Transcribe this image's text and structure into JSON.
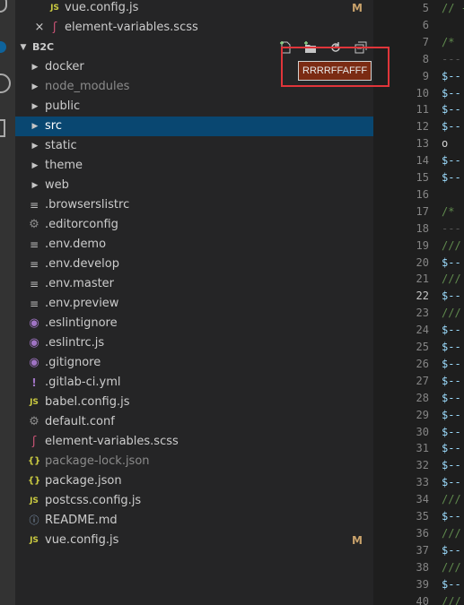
{
  "open_editors": [
    {
      "label": "vue.config.js",
      "icon": "js-file-icon",
      "badge": "M",
      "close": ""
    },
    {
      "label": "element-variables.scss",
      "icon": "sass-file-icon",
      "badge": "",
      "close": "×"
    }
  ],
  "section": {
    "title": "B2C"
  },
  "toolbar": {
    "new_file": "new-file",
    "new_folder": "new-folder",
    "refresh": "refresh",
    "collapse_all": "collapse-all"
  },
  "tooltip": {
    "text": "RRRRFFAFFF"
  },
  "tree": [
    {
      "label": "docker",
      "type": "folder",
      "dim": false,
      "selected": false
    },
    {
      "label": "node_modules",
      "type": "folder",
      "dim": true,
      "selected": false
    },
    {
      "label": "public",
      "type": "folder",
      "dim": false,
      "selected": false
    },
    {
      "label": "src",
      "type": "folder",
      "dim": false,
      "selected": true
    },
    {
      "label": "static",
      "type": "folder",
      "dim": false,
      "selected": false
    },
    {
      "label": "theme",
      "type": "folder",
      "dim": false,
      "selected": false
    },
    {
      "label": "web",
      "type": "folder",
      "dim": false,
      "selected": false
    },
    {
      "label": ".browserslistrc",
      "type": "lines",
      "dim": false
    },
    {
      "label": ".editorconfig",
      "type": "gear",
      "dim": false
    },
    {
      "label": ".env.demo",
      "type": "lines",
      "dim": false
    },
    {
      "label": ".env.develop",
      "type": "lines",
      "dim": false
    },
    {
      "label": ".env.master",
      "type": "lines",
      "dim": false
    },
    {
      "label": ".env.preview",
      "type": "lines",
      "dim": false
    },
    {
      "label": ".eslintignore",
      "type": "eslint",
      "dim": false
    },
    {
      "label": ".eslintrc.js",
      "type": "eslint",
      "dim": false
    },
    {
      "label": ".gitignore",
      "type": "eslint",
      "dim": false
    },
    {
      "label": ".gitlab-ci.yml",
      "type": "excl",
      "dim": false
    },
    {
      "label": "babel.config.js",
      "type": "js",
      "dim": false
    },
    {
      "label": "default.conf",
      "type": "gear",
      "dim": false
    },
    {
      "label": "element-variables.scss",
      "type": "sass",
      "dim": false
    },
    {
      "label": "package-lock.json",
      "type": "braces",
      "dim": true
    },
    {
      "label": "package.json",
      "type": "braces",
      "dim": false
    },
    {
      "label": "postcss.config.js",
      "type": "js",
      "dim": false
    },
    {
      "label": "README.md",
      "type": "info",
      "dim": false
    },
    {
      "label": "vue.config.js",
      "type": "js",
      "dim": false,
      "badge": "M"
    }
  ],
  "editor": {
    "active_line": "22",
    "lines": [
      {
        "n": "5",
        "text": "// -"
      },
      {
        "n": "6",
        "text": ""
      },
      {
        "n": "7",
        "text": "/* "
      },
      {
        "n": "8",
        "text": "---"
      },
      {
        "n": "9",
        "text": "$--"
      },
      {
        "n": "10",
        "text": "$--"
      },
      {
        "n": "11",
        "text": "$--"
      },
      {
        "n": "12",
        "text": "$--"
      },
      {
        "n": "13",
        "text": "  o"
      },
      {
        "n": "14",
        "text": "$--"
      },
      {
        "n": "15",
        "text": "$--"
      },
      {
        "n": "16",
        "text": ""
      },
      {
        "n": "17",
        "text": "/* "
      },
      {
        "n": "18",
        "text": "---"
      },
      {
        "n": "19",
        "text": "///"
      },
      {
        "n": "20",
        "text": "$--"
      },
      {
        "n": "21",
        "text": "///"
      },
      {
        "n": "22",
        "text": "$--"
      },
      {
        "n": "23",
        "text": "///"
      },
      {
        "n": "24",
        "text": "$--"
      },
      {
        "n": "25",
        "text": "$--"
      },
      {
        "n": "26",
        "text": "$--"
      },
      {
        "n": "27",
        "text": "$--"
      },
      {
        "n": "28",
        "text": "$--"
      },
      {
        "n": "29",
        "text": "$--"
      },
      {
        "n": "30",
        "text": "$--"
      },
      {
        "n": "31",
        "text": "$--"
      },
      {
        "n": "32",
        "text": "$--"
      },
      {
        "n": "33",
        "text": "$--"
      },
      {
        "n": "34",
        "text": "///"
      },
      {
        "n": "35",
        "text": "$--"
      },
      {
        "n": "36",
        "text": "///"
      },
      {
        "n": "37",
        "text": "$--"
      },
      {
        "n": "38",
        "text": "///"
      },
      {
        "n": "39",
        "text": "$--"
      },
      {
        "n": "40",
        "text": "///"
      }
    ]
  },
  "colors": {
    "selection": "#094771",
    "tooltip_bg": "#7b2b13",
    "highlight_box": "#e0353a",
    "modified_badge": "#c9a26b"
  }
}
